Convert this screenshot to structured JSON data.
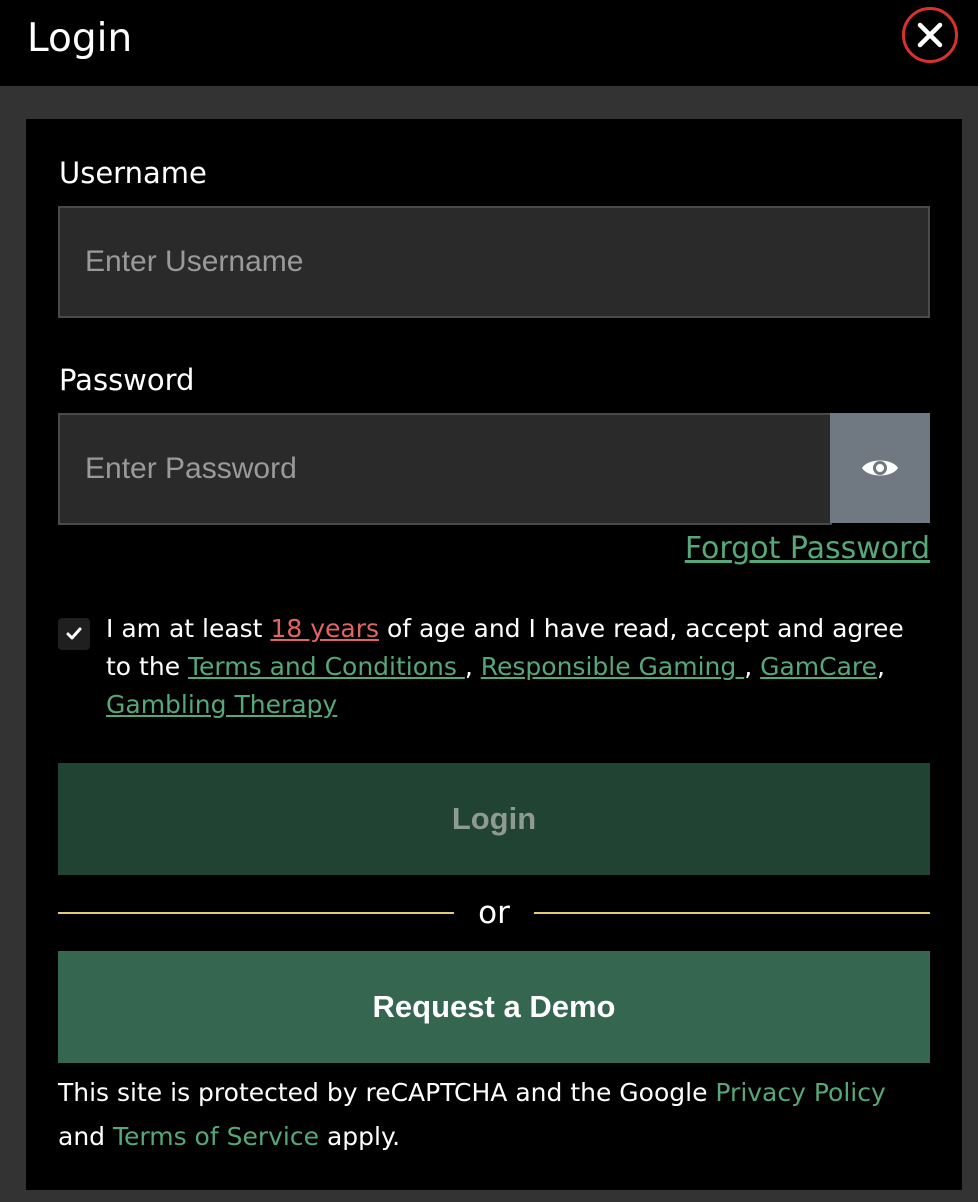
{
  "header": {
    "title": "Login"
  },
  "form": {
    "username_label": "Username",
    "username_placeholder": "Enter Username",
    "password_label": "Password",
    "password_placeholder": "Enter Password",
    "forgot_password": "Forgot Password"
  },
  "agreement": {
    "text_1": "I am at least ",
    "age_link": "18 years",
    "text_2": " of age and I have read, accept and agree to the ",
    "terms_link": "Terms and Conditions ",
    "sep_1": ", ",
    "responsible_link": "Responsible Gaming ",
    "sep_2": ", ",
    "gamcare_link": "GamCare",
    "sep_3": ", ",
    "therapy_link": "Gambling Therapy",
    "checked": true
  },
  "actions": {
    "login_label": "Login",
    "or_label": "or",
    "demo_label": "Request a Demo"
  },
  "recaptcha": {
    "text_1": "This site is protected by reCAPTCHA and the Google ",
    "privacy_link": "Privacy Policy",
    "text_2": " and ",
    "terms_link": "Terms of Service",
    "text_3": " apply."
  },
  "icons": {
    "close": "close-icon",
    "eye": "eye-icon",
    "check": "check-icon"
  },
  "colors": {
    "accent_green": "#56a779",
    "login_button": "#214334",
    "demo_button": "#356650",
    "close_ring": "#d9322c",
    "age_link": "#e26565",
    "divider": "#e7c97a"
  }
}
